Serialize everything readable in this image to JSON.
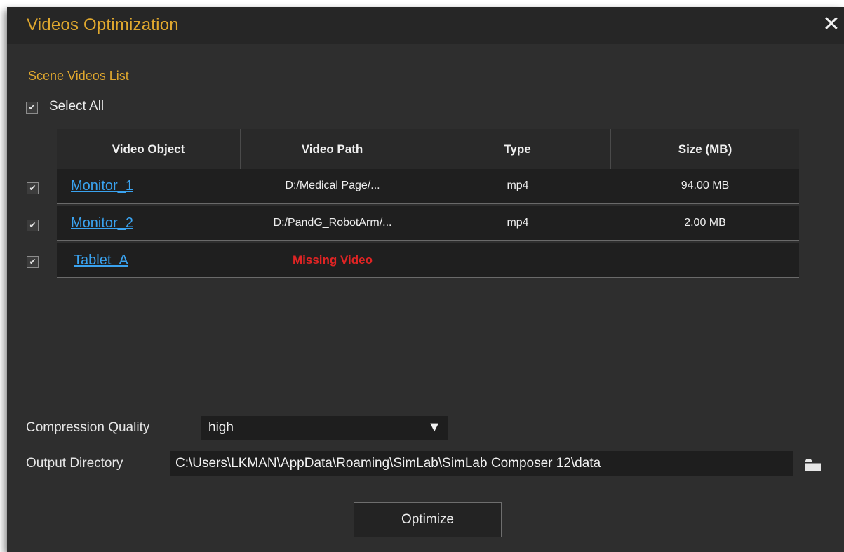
{
  "window": {
    "title": "Videos Optimization",
    "close_glyph": "✕"
  },
  "videos": {
    "section_title": "Scene Videos List",
    "select_all_label": "Select All",
    "select_all_checked": true,
    "columns": [
      "Video Object",
      "Video Path",
      "Type",
      "Size (MB)"
    ],
    "rows": [
      {
        "checked": true,
        "object": "Monitor_1",
        "path": "D:/Medical Page/...",
        "type": "mp4",
        "size": "94.00 MB",
        "status": ""
      },
      {
        "checked": true,
        "object": "Monitor_2",
        "path": "D:/PandG_RobotArm/...",
        "type": "mp4",
        "size": "2.00 MB",
        "status": ""
      },
      {
        "checked": true,
        "object": "Tablet_A",
        "path": "",
        "type": "",
        "size": "",
        "status": "Missing Video"
      }
    ]
  },
  "settings": {
    "compression_label": "Compression Quality",
    "compression_value": "high",
    "output_label": "Output Directory",
    "output_value": "C:\\Users\\LKMAN\\AppData\\Roaming\\SimLab\\SimLab Composer 12\\data"
  },
  "actions": {
    "optimize_label": "Optimize"
  },
  "colors": {
    "accent": "#e0a82e",
    "link": "#3aa3f0",
    "error": "#e02424",
    "background": "#2e2e2e"
  },
  "icons": {
    "close": "close-icon",
    "dropdown": "chevron-down-icon",
    "checkbox": "check-icon",
    "folder": "folder-icon"
  }
}
